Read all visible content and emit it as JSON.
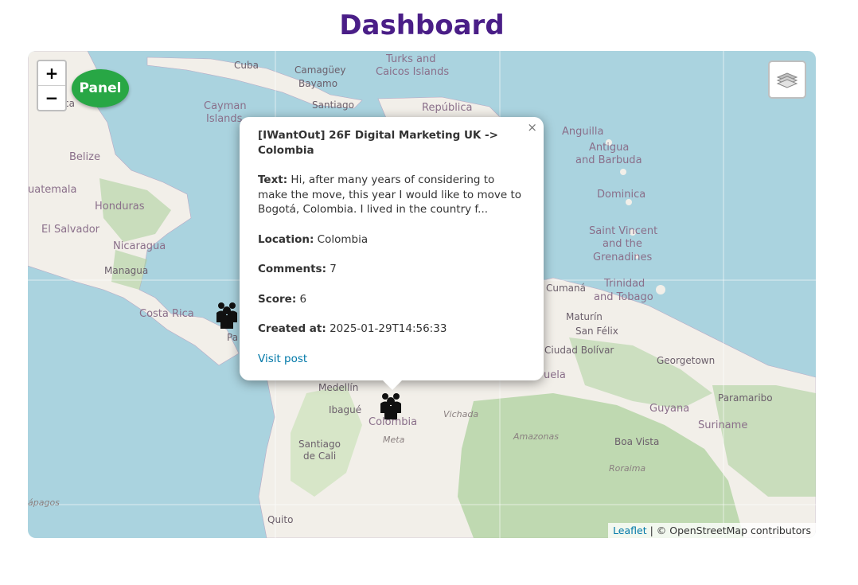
{
  "page": {
    "title": "Dashboard"
  },
  "map": {
    "zoom_in": "+",
    "zoom_out": "−",
    "panel_button": "Panel",
    "layers_icon": "layers-icon",
    "attribution": {
      "leaflet": "Leaflet",
      "separator": " | © OpenStreetMap contributors"
    },
    "labels": {
      "cuba": "Cuba",
      "camaguey": "Camagüey",
      "bayamo": "Bayamo",
      "santiago": "Santiago",
      "turks1": "Turks and",
      "turks2": "Caicos Islands",
      "cayman1": "Cayman",
      "cayman2": "Islands",
      "republica": "República",
      "anguilla": "Anguilla",
      "antigua1": "Antigua",
      "antigua2": "and Barbuda",
      "dominica": "Dominica",
      "svincent1": "Saint Vincent",
      "svincent2": "and the",
      "svincent3": "Grenadines",
      "belize": "Belize",
      "guatemala": "uatemala",
      "honduras": "Honduras",
      "elsalvador": "El Salvador",
      "nicaragua": "Nicaragua",
      "managua": "Managua",
      "costarica": "Costa Rica",
      "pa": "Pa",
      "cumana": "Cumaná",
      "trinidad1": "Trinidad",
      "trinidad2": "and Tobago",
      "maturin": "Maturín",
      "sanfelix": "San Félix",
      "ciudadbolivar": "Ciudad Bolívar",
      "uela": "uela",
      "georgetown": "Georgetown",
      "paramaribo": "Paramaribo",
      "guyana": "Guyana",
      "suriname": "Suriname",
      "medellin": "Medellín",
      "ibague": "Ibagué",
      "colombia": "Colombia",
      "vichada": "Vichada",
      "meta": "Meta",
      "amazonas": "Amazonas",
      "boavista": "Boa Vista",
      "roraima": "Roraima",
      "santiagocali1": "Santiago",
      "santiagocali2": "de Cali",
      "quito": "Quito",
      "galapagos": "ápagos",
      "ca": "ca"
    },
    "markers": [
      {
        "name": "marker-costa-rica",
        "icon": "group-icon"
      },
      {
        "name": "marker-colombia",
        "icon": "group-icon"
      }
    ]
  },
  "popup": {
    "title": "[IWantOut] 26F Digital Marketing UK -> Colombia",
    "close": "×",
    "text_label": "Text:",
    "text_value": " Hi, after many years of considering to make the move, this year I would like to move to Bogotá, Colombia. I lived in the country f...",
    "location_label": "Location:",
    "location_value": " Colombia",
    "comments_label": "Comments:",
    "comments_value": " 7",
    "score_label": "Score:",
    "score_value": " 6",
    "created_label": "Created at:",
    "created_value": " 2025-01-29T14:56:33",
    "link": "Visit post"
  },
  "colors": {
    "title": "#4a1e87",
    "panel": "#28a745",
    "water": "#aad3df",
    "land": "#f2efe9",
    "forest": "#add19e",
    "link": "#0078a8"
  }
}
